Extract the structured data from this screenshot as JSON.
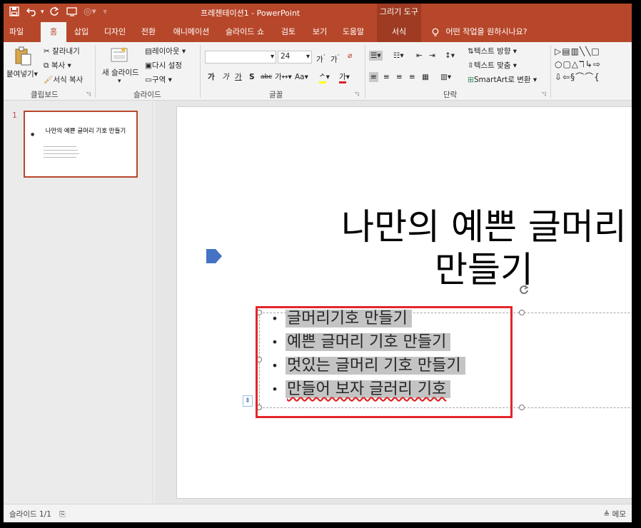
{
  "titlebar": {
    "doc_title": "프레젠테이션1 - PowerPoint",
    "context_group": "그리기 도구",
    "save_icon": "save-icon",
    "undo_icon": "undo-icon",
    "redo_icon": "redo-icon",
    "start_icon": "start-from-beginning-icon"
  },
  "tabs": [
    {
      "label": "파일"
    },
    {
      "label": "홈"
    },
    {
      "label": "삽입"
    },
    {
      "label": "디자인"
    },
    {
      "label": "전환"
    },
    {
      "label": "애니메이션"
    },
    {
      "label": "슬라이드 쇼"
    },
    {
      "label": "검토"
    },
    {
      "label": "보기"
    },
    {
      "label": "도움말"
    },
    {
      "label": "서식"
    }
  ],
  "tellme": "어떤 작업을 원하시나요?",
  "ribbon": {
    "clipboard": {
      "paste": "붙여넣기",
      "cut": "잘라내기",
      "copy": "복사",
      "format_painter": "서식 복사",
      "label": "클립보드"
    },
    "slides": {
      "new_slide": "새 슬라이드",
      "layout": "레이아웃",
      "reset": "다시 설정",
      "section": "구역",
      "label": "슬라이드"
    },
    "font": {
      "font_size": "24",
      "label": "글꼴"
    },
    "paragraph": {
      "text_direction": "텍스트 방향",
      "align_text": "텍스트 맞춤",
      "smartart": "SmartArt로 변환",
      "label": "단락"
    }
  },
  "thumbnail": {
    "number": "1",
    "title": "나만의 예쁜 글머리 기호 만들기"
  },
  "slide": {
    "title_line1": "나만의 예쁜 글머리",
    "title_line2": "만들기",
    "bullets": [
      "글머리기호 만들기",
      "예쁜 글머리 기호 만들기",
      "멋있는 글머리 기호 만들기",
      "만들어 보자 글러리 기호"
    ]
  },
  "status": {
    "slide_info": "슬라이드 1/1",
    "notes": "메모"
  },
  "colors": {
    "accent": "#b7472a",
    "highlight_box": "#e3262b",
    "text_highlight": "#c4c4c4"
  }
}
